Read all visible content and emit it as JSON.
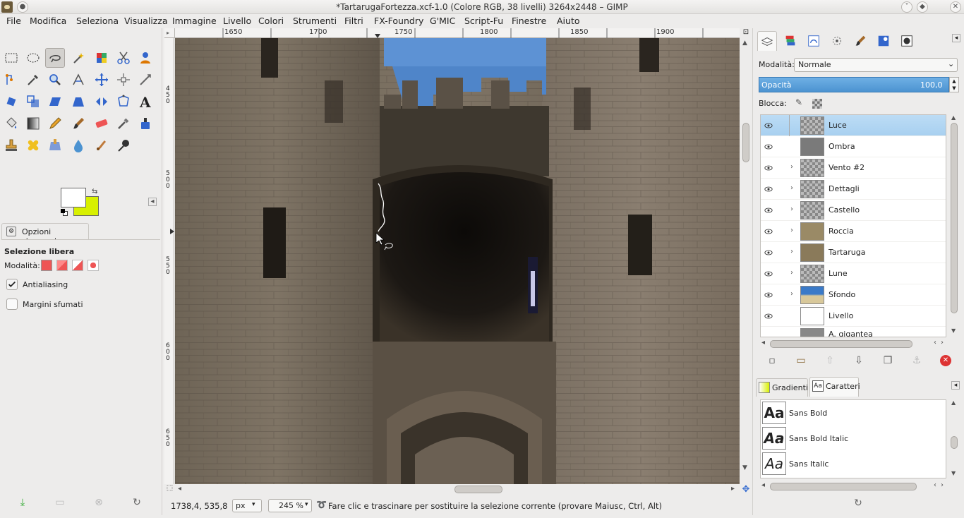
{
  "window": {
    "title": "*TartarugaFortezza.xcf-1.0 (Colore RGB, 38 livelli) 3264x2448 – GIMP"
  },
  "menubar": {
    "items": [
      "File",
      "Modifica",
      "Seleziona",
      "Visualizza",
      "Immagine",
      "Livello",
      "Colori",
      "Strumenti",
      "Filtri",
      "FX-Foundry",
      "G'MIC",
      "Script-Fu",
      "Finestre",
      "Aiuto"
    ]
  },
  "colors": {
    "foreground": "#ffffff",
    "background": "#d8f000",
    "accent": "#4c93d1"
  },
  "tool_options": {
    "tab_label": "Opzioni strumento",
    "tool_name": "Selezione libera",
    "mode_label": "Modalità:",
    "antialiasing_label": "Antialiasing",
    "antialiasing_checked": true,
    "feather_label": "Margini sfumati",
    "feather_checked": false
  },
  "ruler": {
    "top_ticks": [
      "1650",
      "1700",
      "1750",
      "1800",
      "1850",
      "1900"
    ],
    "left_ticks": [
      "450",
      "500",
      "550",
      "600",
      "650"
    ]
  },
  "status": {
    "coords": "1738,4, 535,8",
    "unit": "px",
    "zoom": "245 %",
    "message": "Fare clic e trascinare per sostituire la selezione corrente (provare Maiusc, Ctrl, Alt)"
  },
  "layers_panel": {
    "mode_label": "Modalità:",
    "mode_value": "Normale",
    "opacity_label": "Opacità",
    "opacity_value": "100,0",
    "lock_label": "Blocca:",
    "layers": [
      {
        "name": "Luce",
        "selected": true,
        "expandable": false
      },
      {
        "name": "Ombra",
        "selected": false,
        "expandable": false
      },
      {
        "name": "Vento #2",
        "selected": false,
        "expandable": true
      },
      {
        "name": "Dettagli",
        "selected": false,
        "expandable": true
      },
      {
        "name": "Castello",
        "selected": false,
        "expandable": true
      },
      {
        "name": "Roccia",
        "selected": false,
        "expandable": true
      },
      {
        "name": "Tartaruga",
        "selected": false,
        "expandable": true
      },
      {
        "name": "Lune",
        "selected": false,
        "expandable": true
      },
      {
        "name": "Sfondo",
        "selected": false,
        "expandable": true
      },
      {
        "name": "Livello",
        "selected": false,
        "expandable": false
      },
      {
        "name": "A. gigantea Aldabra_Giant_Tortoi",
        "selected": false,
        "expandable": false
      }
    ]
  },
  "fonts_panel": {
    "tabs": [
      "Gradienti",
      "Caratteri"
    ],
    "fonts": [
      {
        "preview": "Aa",
        "name": "Sans Bold"
      },
      {
        "preview": "Aa",
        "name": "Sans Bold Italic"
      },
      {
        "preview": "Aa",
        "name": "Sans Italic"
      }
    ]
  }
}
